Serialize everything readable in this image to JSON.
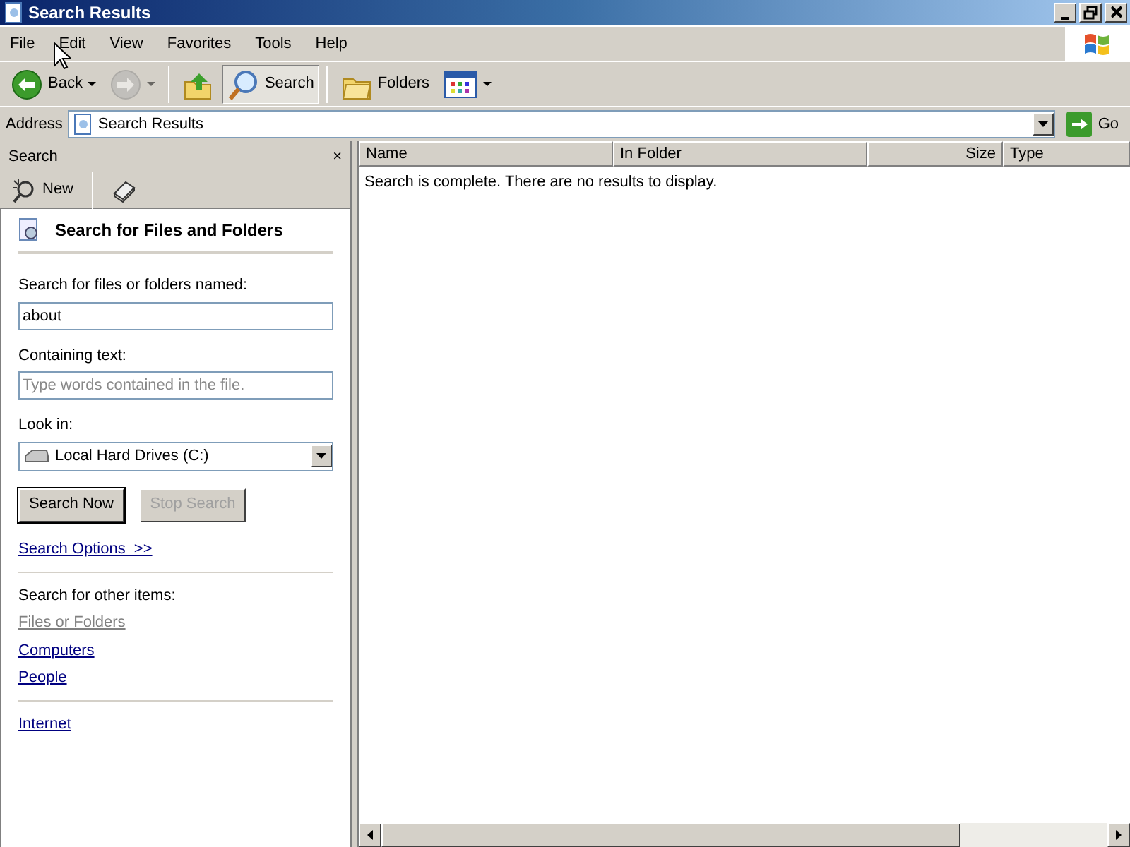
{
  "window": {
    "title": "Search Results"
  },
  "menu": [
    "File",
    "Edit",
    "View",
    "Favorites",
    "Tools",
    "Help"
  ],
  "toolbar": [
    {
      "kind": "back",
      "label": "Back",
      "disabled": false,
      "selected": false
    },
    {
      "kind": "forward",
      "disabled": true,
      "selected": false
    },
    {
      "kind": "up",
      "disabled": false,
      "selected": false
    },
    {
      "kind": "search",
      "label": "Search",
      "disabled": false,
      "selected": true
    },
    {
      "kind": "folders",
      "label": "Folders",
      "disabled": false,
      "selected": false
    },
    {
      "kind": "views",
      "disabled": false,
      "selected": false
    }
  ],
  "address": {
    "label": "Address",
    "value": "Search Results",
    "go": "Go"
  },
  "search_pane": {
    "title": "Search",
    "close": "×",
    "new": "New",
    "heading": "Search for Files and Folders",
    "name_label": "Search for files or folders named:",
    "name_value": "about",
    "text_label": "Containing text:",
    "text_placeholder": "Type words contained in the file.",
    "look_in_label": "Look in:",
    "look_in_value": "Local Hard Drives (C:)",
    "buttons": [
      {
        "label": "Search Now",
        "disabled": false
      },
      {
        "label": "Stop Search",
        "disabled": true
      }
    ],
    "options_link": "Search Options  >>",
    "other_label": "Search for other items:",
    "other_link_groups": [
      [
        {
          "label": "Files or Folders",
          "disabled": true
        },
        {
          "label": "Computers",
          "disabled": false
        },
        {
          "label": "People",
          "disabled": false
        }
      ],
      [
        {
          "label": "Internet",
          "disabled": false
        }
      ]
    ]
  },
  "results": {
    "columns": [
      "Name",
      "In Folder",
      "Size",
      "Type"
    ],
    "message": "Search is complete. There are no results to display."
  }
}
